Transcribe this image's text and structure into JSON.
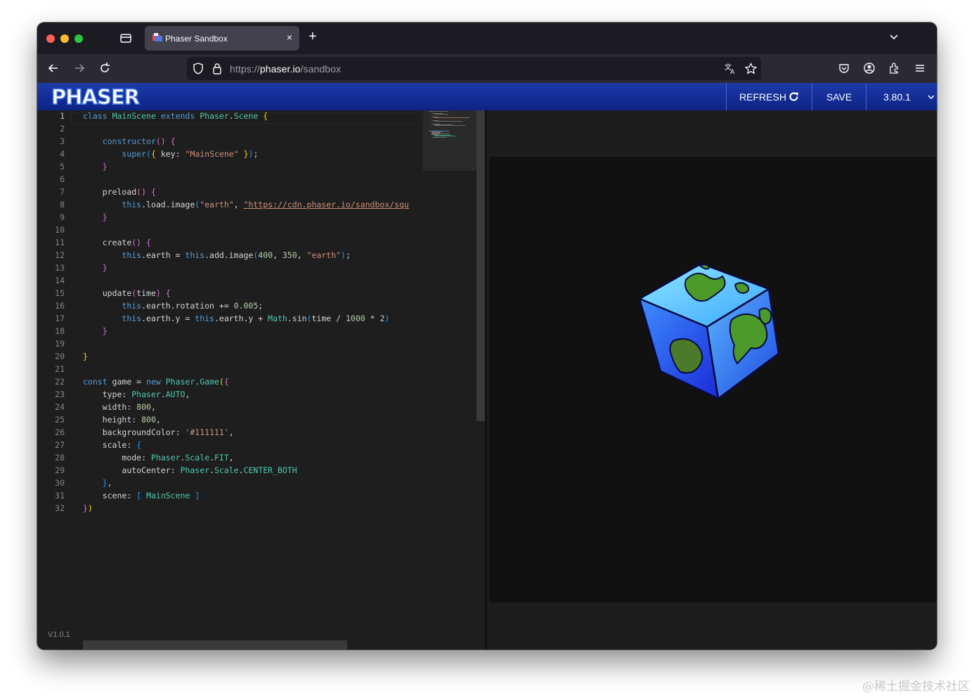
{
  "browser": {
    "tab_title": "Phaser Sandbox",
    "tab_close": "×",
    "new_tab": "+",
    "url_scheme": "https://",
    "url_host": "phaser.io",
    "url_path": "/sandbox"
  },
  "header": {
    "logo": "PHASER",
    "refresh_label": "REFRESH",
    "save_label": "SAVE",
    "version_select": "3.80.1"
  },
  "editor": {
    "line_numbers": [
      "1",
      "2",
      "3",
      "4",
      "5",
      "6",
      "7",
      "8",
      "9",
      "10",
      "11",
      "12",
      "13",
      "14",
      "15",
      "16",
      "17",
      "18",
      "19",
      "20",
      "21",
      "22",
      "23",
      "24",
      "25",
      "26",
      "27",
      "28",
      "29",
      "30",
      "31",
      "32"
    ],
    "app_version": "V1.0.1",
    "tokens": {
      "class": "class",
      "mainscene": "MainScene",
      "extends": "extends",
      "phaser": "Phaser",
      "scene": "Scene",
      "constructor": "constructor",
      "super": "super",
      "key": "key",
      "mainscene_str": "\"MainScene\"",
      "preload": "preload",
      "this": "this",
      "load_image": ".load.image",
      "earth_str": "\"earth\"",
      "cdn_url": "\"https://cdn.phaser.io/sandbox/squ",
      "create": "create",
      "earth_assign": ".earth = ",
      "add_image": ".add.image",
      "n400": "400",
      "n350": "350",
      "update": "update",
      "time": "time",
      "rotation": ".earth.rotation += ",
      "n0005": "0.005",
      "earth_y": ".earth.y = ",
      "earth_y2": ".earth.y + ",
      "math": "Math",
      "sin": ".sin",
      "div": " / ",
      "n1000": "1000",
      "mul": " * ",
      "n2": "2",
      "const": "const",
      "game": " game = ",
      "new": "new",
      "game_cls": "Game",
      "type": "type",
      "auto": "AUTO",
      "width": "width",
      "n800": "800",
      "height": "height",
      "bgcolor": "backgroundColor",
      "color_str": "'#111111'",
      "scale": "scale",
      "mode": "mode",
      "scale_cls": "Scale",
      "fit": "FIT",
      "autocenter": "autoCenter",
      "center_both": "CENTER_BOTH",
      "scene_key": "scene"
    }
  },
  "colors": {
    "header_blue": "#1d3aa8",
    "editor_bg": "#1e1e1e",
    "canvas_bg": "#111111"
  },
  "watermark": "@稀土掘金技术社区"
}
